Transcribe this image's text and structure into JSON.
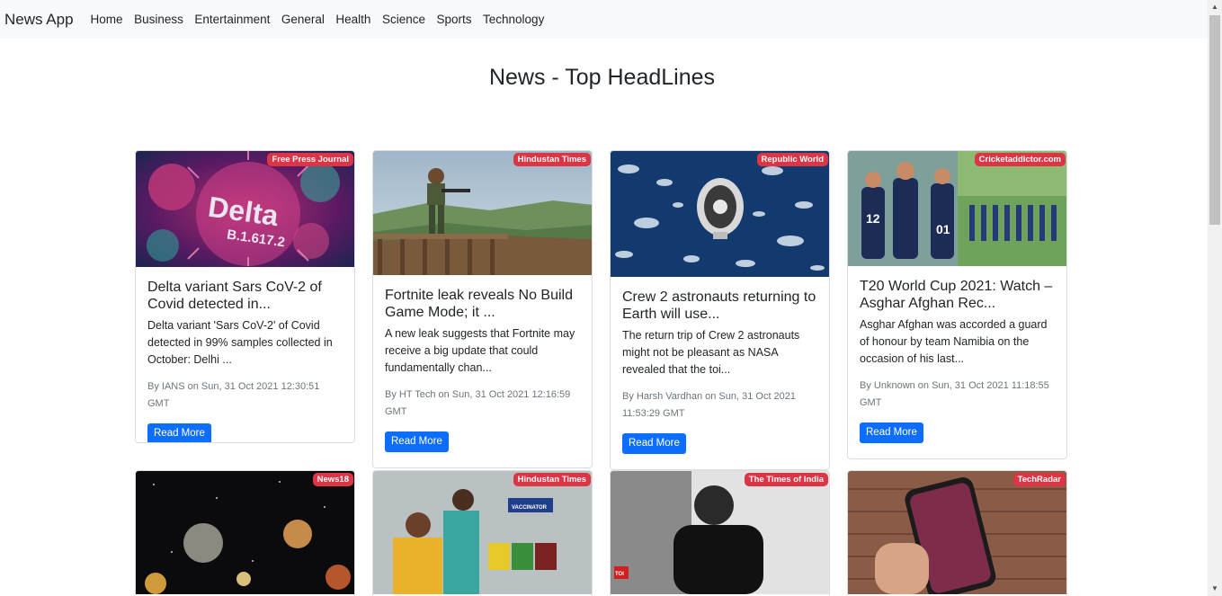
{
  "navbar": {
    "brand": "News App",
    "links": [
      "Home",
      "Business",
      "Entertainment",
      "General",
      "Health",
      "Science",
      "Sports",
      "Technology"
    ]
  },
  "page": {
    "title": "News - Top HeadLines"
  },
  "cards": [
    {
      "source": "Free Press Journal",
      "title": "Delta variant Sars CoV-2 of Covid detected in...",
      "description": "Delta variant 'Sars CoV-2' of Covid detected in 99% samples collected in October: Delhi ...",
      "meta": "By IANS on Sun, 31 Oct 2021 12:30:51 GMT",
      "button": "Read More",
      "image": "delta-virus-image"
    },
    {
      "source": "Hindustan Times",
      "title": "Fortnite leak reveals No Build Game Mode; it ...",
      "description": "A new leak suggests that Fortnite may receive a big update that could fundamentally chan...",
      "meta": "By HT Tech on Sun, 31 Oct 2021 12:16:59 GMT",
      "button": "Read More",
      "image": "fortnite-image"
    },
    {
      "source": "Republic World",
      "title": "Crew 2 astronauts returning to Earth will use...",
      "description": "The return trip of Crew 2 astronauts might not be pleasant as NASA revealed that the toi...",
      "meta": "By Harsh Vardhan on Sun, 31 Oct 2021 11:53:29 GMT",
      "button": "Read More",
      "image": "spacecraft-image"
    },
    {
      "source": "Cricketaddictor.com",
      "title": "T20 World Cup 2021: Watch – Asghar Afghan Rec...",
      "description": "Asghar Afghan was accorded a guard of honour by team Namibia on the occasion of his last...",
      "meta": "By Unknown on Sun, 31 Oct 2021 11:18:55 GMT",
      "button": "Read More",
      "image": "cricket-image"
    },
    {
      "source": "News18",
      "image": "planets-image"
    },
    {
      "source": "Hindustan Times",
      "image": "vaccination-image",
      "image_text": "VACCINATOR"
    },
    {
      "source": "The Times of India",
      "image": "portrait-image",
      "image_text": "TOI"
    },
    {
      "source": "TechRadar",
      "image": "smartphone-image"
    }
  ]
}
